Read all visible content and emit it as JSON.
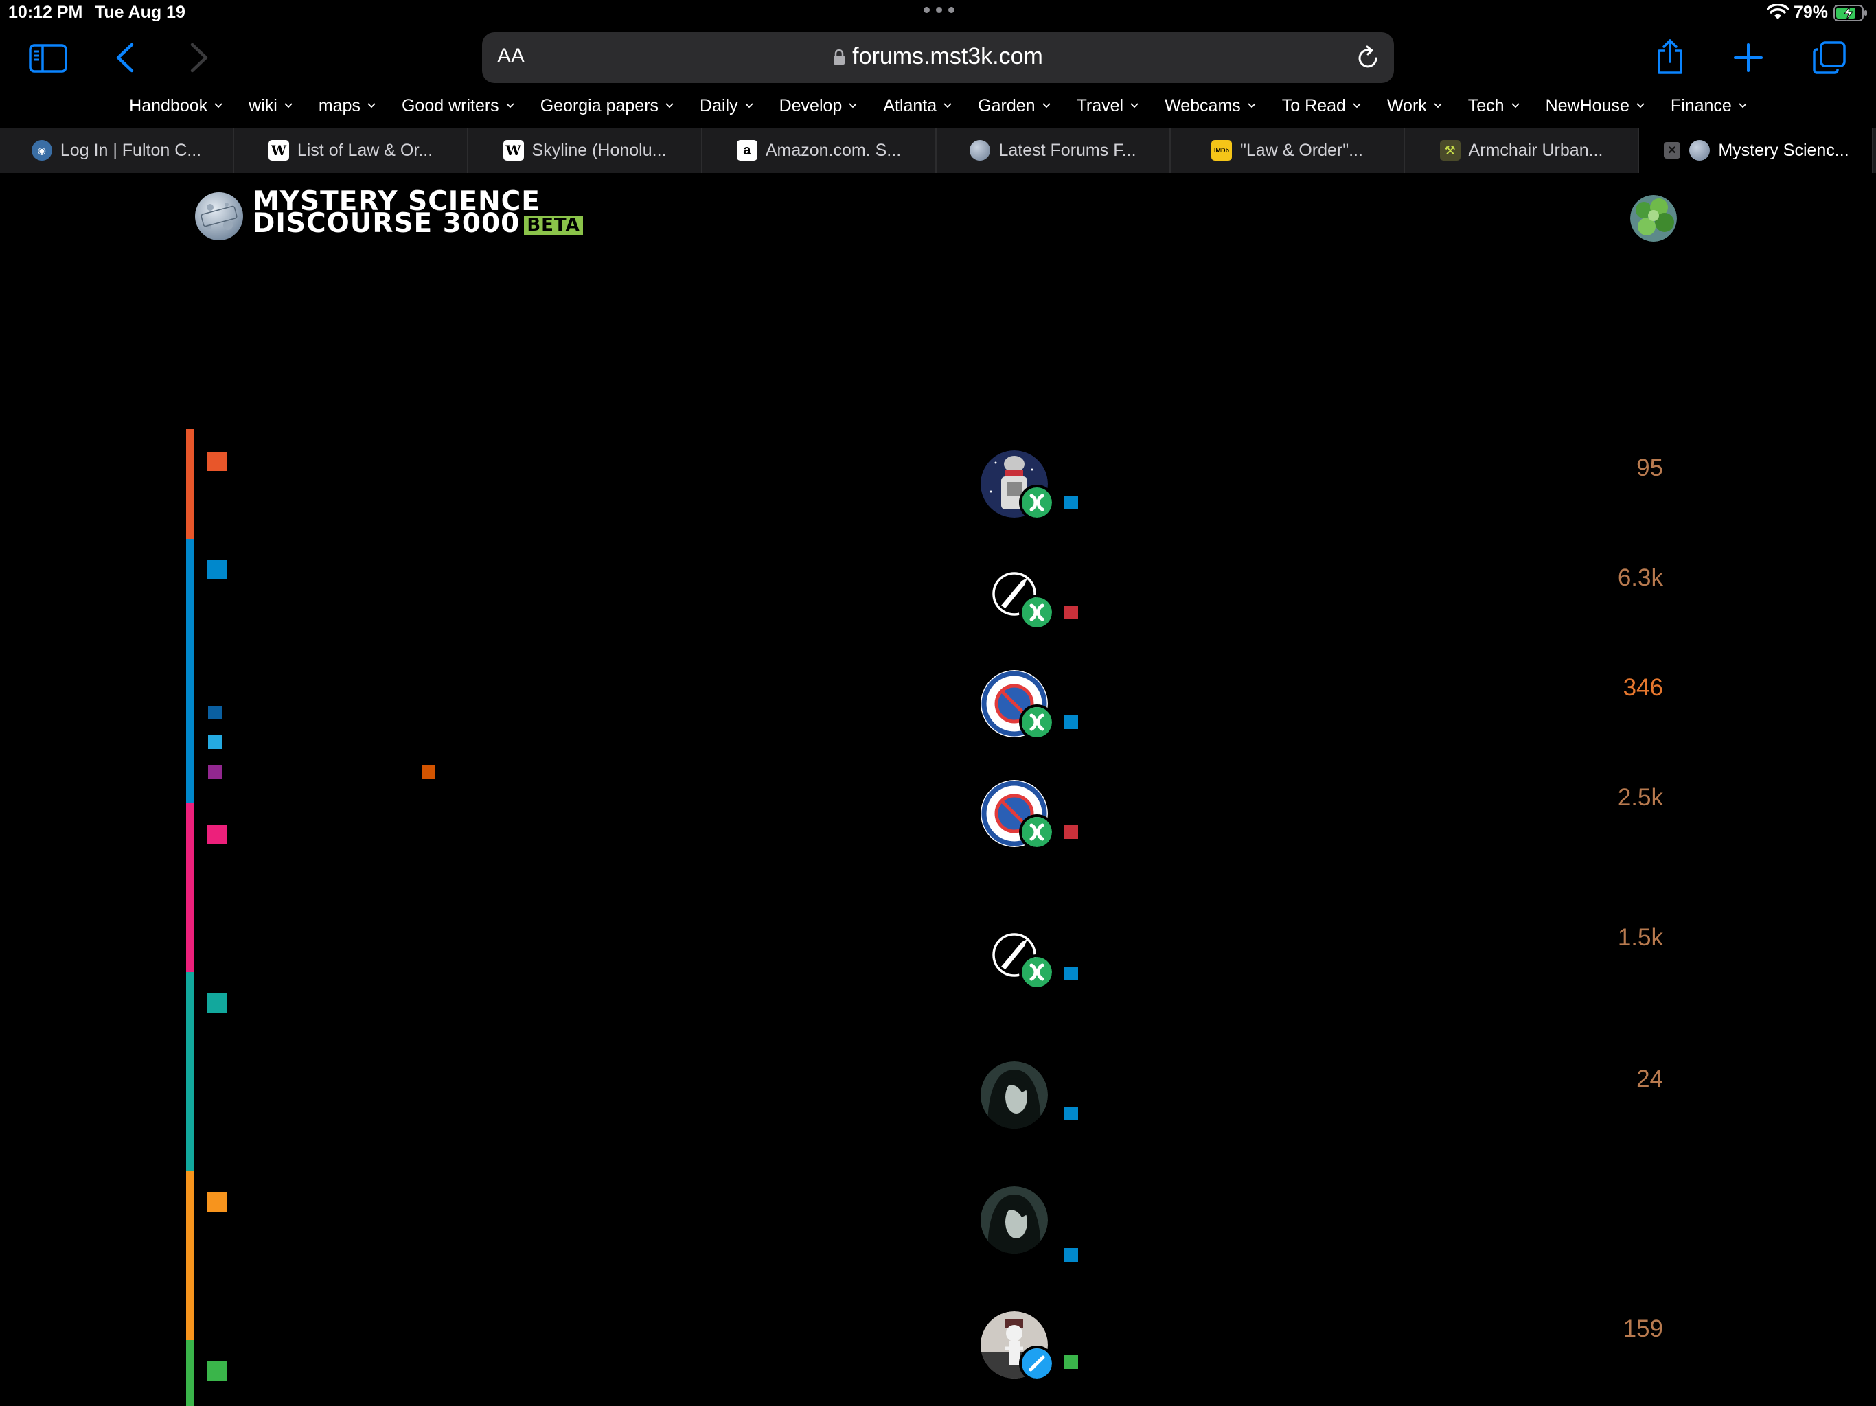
{
  "status_bar": {
    "time": "10:12 PM",
    "date": "Tue Aug 19",
    "battery": "79%"
  },
  "browser": {
    "text_size_label": "AA",
    "url": "forums.mst3k.com",
    "bookmarks": [
      "Handbook",
      "wiki",
      "maps",
      "Good writers",
      "Georgia papers",
      "Daily",
      "Develop",
      "Atlanta",
      "Garden",
      "Travel",
      "Webcams",
      "To Read",
      "Work",
      "Tech",
      "NewHouse",
      "Finance"
    ],
    "tabs": [
      {
        "title": "Log In | Fulton C...",
        "favicon": "globe-seal"
      },
      {
        "title": "List of Law & Or...",
        "favicon": "W"
      },
      {
        "title": "Skyline (Honolu...",
        "favicon": "W"
      },
      {
        "title": "Amazon.com. S...",
        "favicon": "a"
      },
      {
        "title": "Latest Forums F...",
        "favicon": "globe"
      },
      {
        "title": "\"Law & Order\"...",
        "favicon": "IMDb"
      },
      {
        "title": "Armchair Urban...",
        "favicon": "crane"
      },
      {
        "title": "Mystery Scienc...",
        "favicon": "globe",
        "active": true
      }
    ]
  },
  "site": {
    "title_line1": "MYSTERY SCIENCE",
    "title_line2": "DISCOURSE 3000",
    "beta_label": "BETA"
  },
  "colors": {
    "category_bars": [
      "#e8562a",
      "#0088cc",
      "#ed207b",
      "#12a89d",
      "#f7941d",
      "#3ab54a"
    ],
    "count_normal": "#b87a4f",
    "count_hot": "#e6772e"
  },
  "topics": {
    "counts": [
      "95",
      "6.3k",
      "346",
      "2.5k",
      "1.5k",
      "24",
      "159"
    ]
  }
}
